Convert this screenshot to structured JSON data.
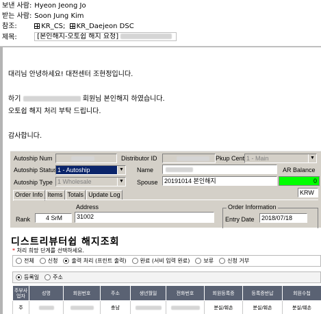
{
  "header": {
    "from_label": "보낸 사람:",
    "from_value": "Hyeon Jeong Jo",
    "to_label": "받는 사람:",
    "to_value": "Soon Jung Kim",
    "cc_label": "참조:",
    "cc_groups": [
      "KR_CS;",
      "KR_Daejeon DSC"
    ],
    "subject_label": "제목:",
    "subject_value": "[본인해지-오토쉽 해지 요청]"
  },
  "body": {
    "greeting": "대리님 안녕하세요! 대전센터 조현정입니다.",
    "line1_prefix": "하기",
    "line1_suffix": "회원님 본인해지 하였습니다.",
    "line2": "오토쉽 해지 처리 부탁 드립니다.",
    "closing": "감사합니다."
  },
  "autoship_panel": {
    "autoship_num_label": "Autoship Num",
    "distributor_id_label": "Distributor ID",
    "pkup_center_label": "Pkup Center",
    "pkup_center_value": "1 - Main",
    "autoship_status_label": "Autoship Status",
    "autoship_status_value": "1 - Autoship",
    "name_label": "Name",
    "ar_balance_label": "AR Balance",
    "ar_balance_value": "0",
    "autoship_type_label": "Autoship Type",
    "autoship_type_value": "1 Wholesale",
    "spouse_label": "Spouse",
    "spouse_value": "20191014 본인해지",
    "currency": "KRW",
    "tabs": [
      "Order Info",
      "Items",
      "Totals",
      "Update Log"
    ],
    "address_label": "Address",
    "address_value": "31002",
    "rank_label": "Rank",
    "rank_num": "4",
    "rank_code": "SrM",
    "order_info_label": "Order Information",
    "entry_date_label": "Entry Date",
    "entry_date_value": "2018/07/18"
  },
  "cancel_screen": {
    "title": "디스트리뷰터쉽 해지조회",
    "subtitle_marker": "*",
    "subtitle": "처리 희망 단계를 선택하세요.",
    "stage_options": [
      {
        "label": "전체",
        "selected": false
      },
      {
        "label": "신청",
        "selected": false
      },
      {
        "label": "출력 처리 (프린트 출력)",
        "selected": true
      },
      {
        "label": "완료 (서비 입력 완료)",
        "selected": false
      },
      {
        "label": "보류",
        "selected": false
      },
      {
        "label": "신청 거부",
        "selected": false
      }
    ],
    "sort_options": [
      {
        "label": "등록일",
        "selected": true
      },
      {
        "label": "주소",
        "selected": false
      }
    ],
    "columns": [
      "주부사업자",
      "성명",
      "회원번호",
      "주소",
      "생년월일",
      "전화번호",
      "회원등록증",
      "등록증반납",
      "회원수첩"
    ],
    "row": [
      "주",
      "",
      "",
      "충남",
      "",
      "",
      "분실/훼손",
      "분실/훼손",
      "분실/훼손"
    ]
  },
  "colors": {
    "ar_balance_fill": "#00ff00",
    "selected_status": "#0a246a",
    "grid_header": "#5a6273"
  }
}
